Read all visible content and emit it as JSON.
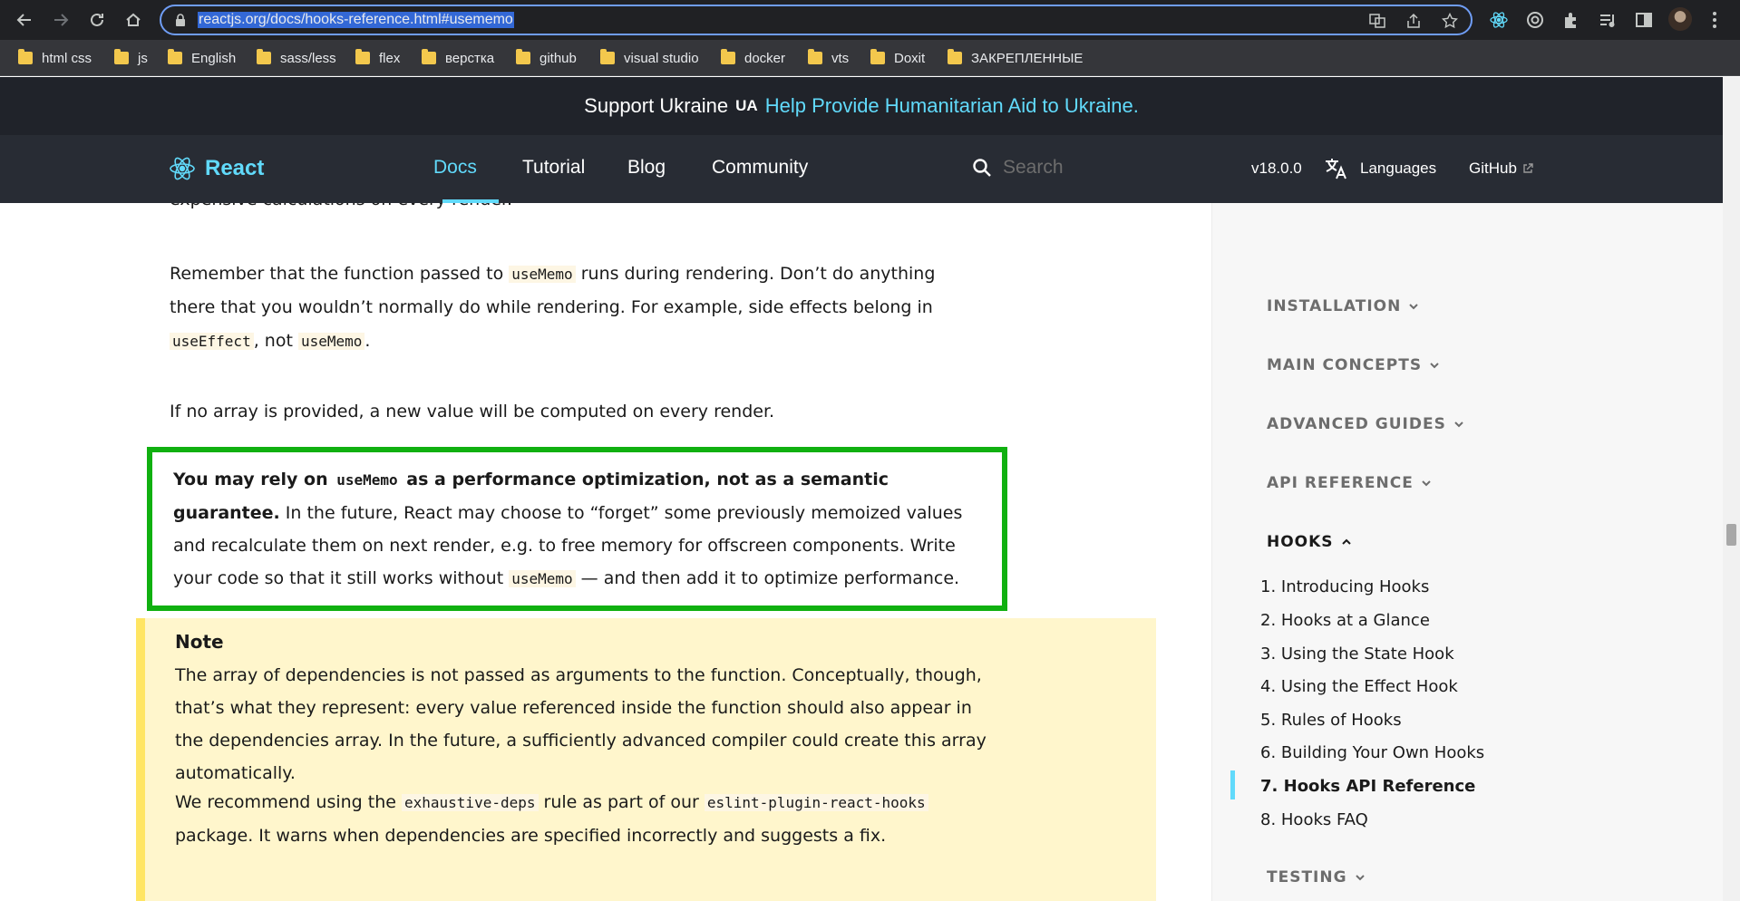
{
  "browser": {
    "url": "reactjs.org/docs/hooks-reference.html#usememo",
    "bookmarks": [
      "html css",
      "js",
      "English",
      "sass/less",
      "flex",
      "верстка",
      "github",
      "visual studio",
      "docker",
      "vts",
      "Doxit",
      "ЗАКРЕПЛЕННЫЕ"
    ]
  },
  "banner": {
    "text": "Support Ukraine",
    "badge": "UA",
    "link": "Help Provide Humanitarian Aid to Ukraine."
  },
  "nav": {
    "brand": "React",
    "links": [
      "Docs",
      "Tutorial",
      "Blog",
      "Community"
    ],
    "active": "Docs",
    "search_placeholder": "Search",
    "version": "v18.0.0",
    "languages": "Languages",
    "github": "GitHub"
  },
  "content": {
    "p0": "expensive calculations on every render.",
    "p1": {
      "a": "Remember that the function passed to ",
      "code1": "useMemo",
      "b": " runs during rendering. Don’t do anything there that you wouldn’t normally do while rendering. For example, side effects belong in ",
      "code2": "useEffect",
      "c": ", not ",
      "code3": "useMemo",
      "d": "."
    },
    "p2": "If no array is provided, a new value will be computed on every render.",
    "callout": {
      "bold_a": "You may rely on ",
      "bold_code": "useMemo",
      "bold_b": " as a performance optimization, not as a semantic guarantee.",
      "a": " In the future, React may choose to “forget” some previously memoized values and recalculate them on next render, e.g. to free memory for offscreen components. Write your code so that it still works without ",
      "code": "useMemo",
      "b": " — and then add it to optimize performance."
    },
    "note": {
      "title": "Note",
      "t1": "The array of dependencies is not passed as arguments to the function. Conceptually, though, that’s what they represent: every value referenced inside the function should also appear in the dependencies array. In the future, a sufficiently advanced compiler could create this array automatically.",
      "t2": {
        "a": "We recommend using the ",
        "code1": "exhaustive-deps",
        "b": " rule as part of our ",
        "code2": "eslint-plugin-react-hooks",
        "c": " package. It warns when dependencies are specified incorrectly and suggests a fix."
      }
    }
  },
  "sidebar": {
    "sections": [
      "INSTALLATION",
      "MAIN CONCEPTS",
      "ADVANCED GUIDES",
      "API REFERENCE",
      "HOOKS",
      "TESTING"
    ],
    "open_section": "HOOKS",
    "hooks_items": [
      "1. Introducing Hooks",
      "2. Hooks at a Glance",
      "3. Using the State Hook",
      "4. Using the Effect Hook",
      "5. Rules of Hooks",
      "6. Building Your Own Hooks",
      "7. Hooks API Reference",
      "8. Hooks FAQ"
    ],
    "active_item": "7. Hooks API Reference"
  },
  "colors": {
    "accent": "#61dafb",
    "header_bg": "#20232a",
    "nav_bg": "#282c34",
    "callout_border": "#10b010",
    "note_bg": "#fff6cc",
    "note_border": "#ffe563"
  }
}
